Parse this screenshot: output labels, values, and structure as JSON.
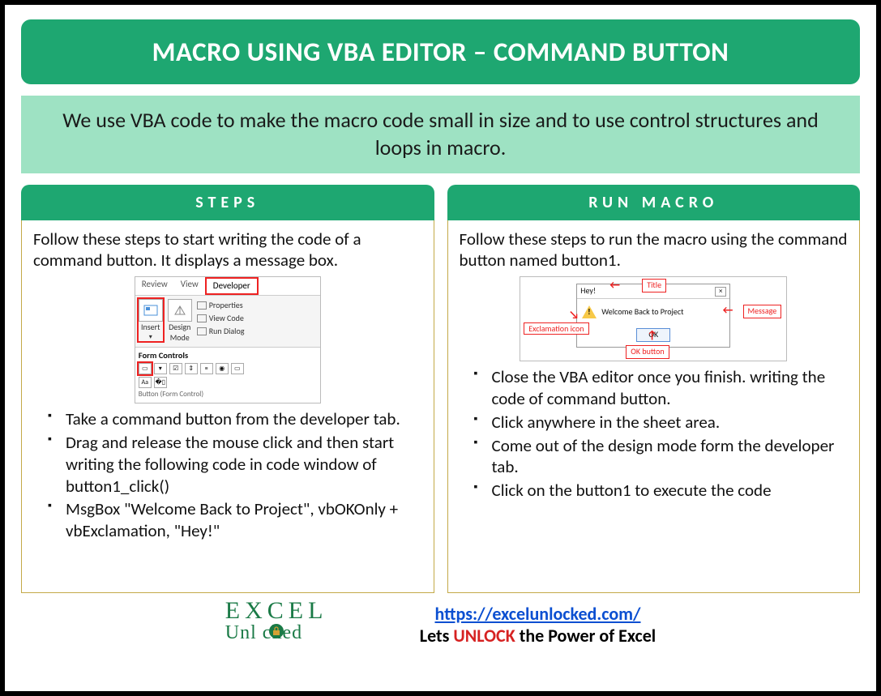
{
  "title": "MACRO USING VBA EDITOR – COMMAND BUTTON",
  "subtitle": "We use VBA code to make the macro code small in size and to use control structures and loops in macro.",
  "steps": {
    "header": "STEPS",
    "intro": "Follow these steps to start writing the code of a command button. It displays a message box.",
    "ribbon": {
      "tabs": {
        "review": "Review",
        "view": "View",
        "developer": "Developer"
      },
      "buttons": {
        "insert": "Insert",
        "design": "Design\nMode"
      },
      "props": {
        "properties": "Properties",
        "viewcode": "View Code",
        "rundialog": "Run Dialog"
      },
      "form_controls_title": "Form Controls",
      "form_controls_caption": "Button (Form Control)"
    },
    "bullets": [
      "Take a command button from the developer tab.",
      "Drag and release the mouse click and then start writing the following code in code window of button1_click()",
      "MsgBox \"Welcome Back to Project\", vbOKOnly + vbExclamation, \"Hey!\""
    ]
  },
  "run": {
    "header": "RUN MACRO",
    "intro": "Follow these steps to run the macro using the command button named button1.",
    "msgbox": {
      "hey": "Hey!",
      "close": "×",
      "message": "Welcome Back to Project",
      "ok": "OK",
      "label_title": "Title",
      "label_message": "Message",
      "label_exclaim": "Exclamation icon",
      "label_okbtn": "OK button"
    },
    "bullets": [
      "Close the VBA editor once you finish. writing the code of command button.",
      "Click anywhere in the sheet area.",
      "Come out of the design mode form the developer tab.",
      "Click on the button1 to execute the code"
    ]
  },
  "footer": {
    "logo_top": "EXCEL",
    "logo_bottom": "Unl   cked",
    "url": "https://excelunlocked.com/",
    "tagline_pre": "Lets ",
    "tagline_unlock": "UNLOCK",
    "tagline_post": " the Power of Excel"
  }
}
